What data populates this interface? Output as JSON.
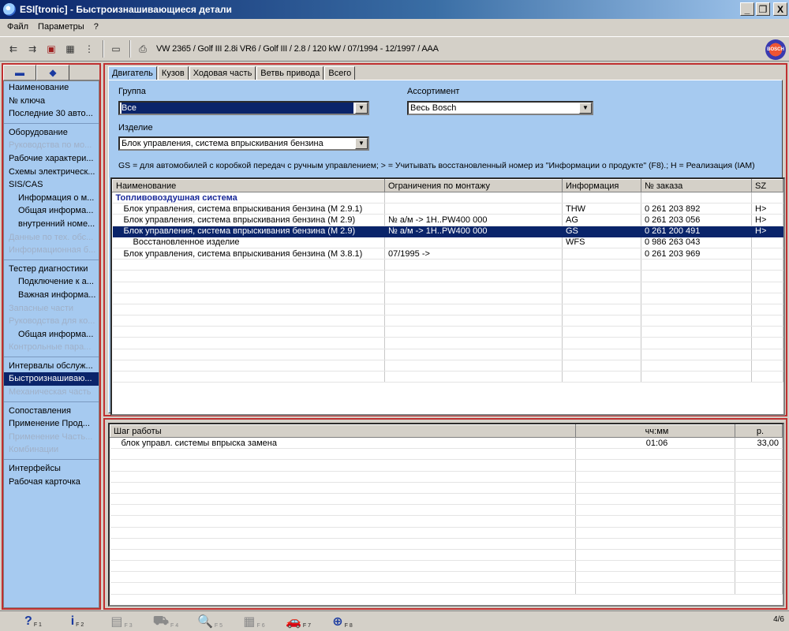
{
  "window": {
    "title": "ESI[tronic] - Быстроизнашивающиеся детали",
    "minimize": "_",
    "restore": "❐",
    "close": "X"
  },
  "menu": [
    "Файл",
    "Параметры",
    "?"
  ],
  "toolbar": {
    "vehicle": "VW 2365 / Golf III 2.8i VR6 / Golf III / 2.8 / 120 kW / 07/1994 - 12/1997 / AAA",
    "logo_text": "BOSCH"
  },
  "sidebar": {
    "items": [
      {
        "label": "Наименование",
        "state": "normal",
        "level": 0
      },
      {
        "label": "№ ключа",
        "state": "normal",
        "level": 0
      },
      {
        "label": "Последние 30 авто...",
        "state": "normal",
        "level": 0
      },
      {
        "label": "Оборудование",
        "state": "normal",
        "level": 0
      },
      {
        "label": "Руководства по мо...",
        "state": "disabled",
        "level": 0
      },
      {
        "label": "Рабочие характери...",
        "state": "normal",
        "level": 0
      },
      {
        "label": "Схемы электрическ...",
        "state": "normal",
        "level": 0
      },
      {
        "label": "SIS/CAS",
        "state": "normal",
        "level": 0
      },
      {
        "label": "Информация о м...",
        "state": "normal",
        "level": 1
      },
      {
        "label": "Общая информа...",
        "state": "normal",
        "level": 1
      },
      {
        "label": "внутренний номе...",
        "state": "normal",
        "level": 1
      },
      {
        "label": "Данные по тех. обс...",
        "state": "disabled",
        "level": 0
      },
      {
        "label": "Информационная б...",
        "state": "disabled",
        "level": 0
      },
      {
        "label": "Тестер диагностики",
        "state": "normal",
        "level": 0
      },
      {
        "label": "Подключение к а...",
        "state": "normal",
        "level": 1
      },
      {
        "label": "Важная информа...",
        "state": "normal",
        "level": 1
      },
      {
        "label": "Запасные части",
        "state": "disabled",
        "level": 0
      },
      {
        "label": "Руководства для ко...",
        "state": "disabled",
        "level": 0
      },
      {
        "label": "Общая информа...",
        "state": "normal",
        "level": 1
      },
      {
        "label": "Контрольные пара...",
        "state": "disabled",
        "level": 0
      },
      {
        "label": "Интервалы обслуж...",
        "state": "normal",
        "level": 0
      },
      {
        "label": "Быстроизнашиваю...",
        "state": "selected",
        "level": 0
      },
      {
        "label": "Механическая часть",
        "state": "disabled",
        "level": 0
      },
      {
        "label": "Сопоставления",
        "state": "normal",
        "level": 0
      },
      {
        "label": "Применение Прод...",
        "state": "normal",
        "level": 0
      },
      {
        "label": "Применение Часть...",
        "state": "disabled",
        "level": 0
      },
      {
        "label": "Комбинации",
        "state": "disabled",
        "level": 0
      },
      {
        "label": "Интерфейсы",
        "state": "normal",
        "level": 0
      },
      {
        "label": "Рабочая карточка",
        "state": "normal",
        "level": 0
      }
    ]
  },
  "tabs": [
    "Двигатель",
    "Кузов",
    "Ходовая часть",
    "Ветвь привода",
    "Всего"
  ],
  "filters": {
    "group_label": "Группа",
    "group_value": "Все",
    "assortment_label": "Ассортимент",
    "assortment_value": "Весь Bosch",
    "product_label": "Изделие",
    "product_value": "Блок управления, система впрыскивания бензина"
  },
  "legend_note": "GS = для автомобилей с коробкой передач с ручным управлением; > = Учитывать восстановленный номер из \"Информации о продукте\" (F8).; H = Реализация (IAM)",
  "parts_table": {
    "headers": [
      "Наименование",
      "Ограничения по монтажу",
      "Информация",
      "№ заказа",
      "SZ"
    ],
    "group_title": "Топливовоздушная система",
    "rows": [
      [
        "Блок управления, система впрыскивания бензина (M 2.9.1)",
        "",
        "THW",
        "0 261 203 892",
        "H>"
      ],
      [
        "Блок управления, система впрыскивания бензина (M 2.9)",
        "№ а/м -> 1H..PW400 000",
        "AG",
        "0 261 203 056",
        "H>"
      ],
      [
        "Блок управления, система впрыскивания бензина (M 2.9)",
        "№ а/м -> 1H..PW400 000",
        "GS",
        "0 261 200 491",
        "H>"
      ],
      [
        "Восстановленное изделие",
        "",
        "WFS",
        "0 986 263 043",
        ""
      ],
      [
        "Блок управления, система впрыскивания бензина (M 3.8.1)",
        "07/1995 ->",
        "",
        "0 261 203 969",
        ""
      ]
    ]
  },
  "work_table": {
    "headers": [
      "Шаг работы",
      "чч:мм",
      "р."
    ],
    "rows": [
      [
        "блок управл. системы впрыска замена",
        "01:06",
        "33,00"
      ]
    ]
  },
  "statusbar": {
    "buttons": [
      {
        "glyph": "?",
        "key": "F 1",
        "state": "normal"
      },
      {
        "glyph": "i",
        "key": "F 2",
        "state": "normal"
      },
      {
        "glyph": "▤",
        "key": "F 3",
        "state": "disabled"
      },
      {
        "glyph": "⛟",
        "key": "F 4",
        "state": "disabled"
      },
      {
        "glyph": "🔍",
        "key": "F 5",
        "state": "disabled"
      },
      {
        "glyph": "▦",
        "key": "F 6",
        "state": "disabled"
      },
      {
        "glyph": "🚗",
        "key": "F 7",
        "state": "normal"
      },
      {
        "glyph": "⊕",
        "key": "F 8",
        "state": "normal"
      }
    ],
    "page": "4/6"
  }
}
